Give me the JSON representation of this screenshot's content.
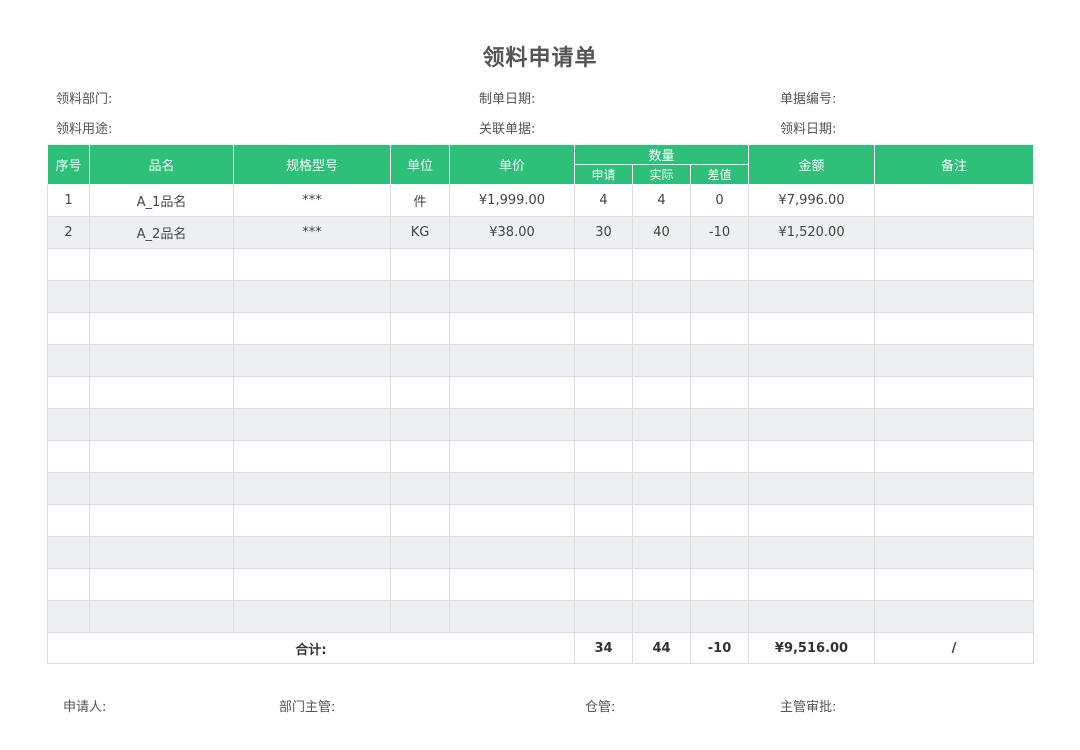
{
  "title": "领料申请单",
  "meta": {
    "dept_label": "领料部门:",
    "date_made_label": "制单日期:",
    "doc_no_label": "单据编号:",
    "purpose_label": "领料用途:",
    "related_doc_label": "关联单据:",
    "pick_date_label": "领料日期:"
  },
  "headers": {
    "seq": "序号",
    "name": "品名",
    "spec": "规格型号",
    "unit": "单位",
    "price": "单价",
    "qty": "数量",
    "qty_apply": "申请",
    "qty_actual": "实际",
    "qty_diff": "差值",
    "amount": "金额",
    "note": "备注"
  },
  "rows": [
    {
      "seq": "1",
      "name": "A_1品名",
      "spec": "***",
      "unit": "件",
      "price": "¥1,999.00",
      "apply": "4",
      "actual": "4",
      "diff": "0",
      "amount": "¥7,996.00",
      "note": ""
    },
    {
      "seq": "2",
      "name": "A_2品名",
      "spec": "***",
      "unit": "KG",
      "price": "¥38.00",
      "apply": "30",
      "actual": "40",
      "diff": "-10",
      "amount": "¥1,520.00",
      "note": ""
    }
  ],
  "total": {
    "label": "合计:",
    "apply": "34",
    "actual": "44",
    "diff": "-10",
    "amount": "¥9,516.00",
    "note": "/"
  },
  "signatures": {
    "applicant": "申请人:",
    "dept_head": "部门主管:",
    "warehouse": "仓管:",
    "approval": "主管审批:"
  }
}
